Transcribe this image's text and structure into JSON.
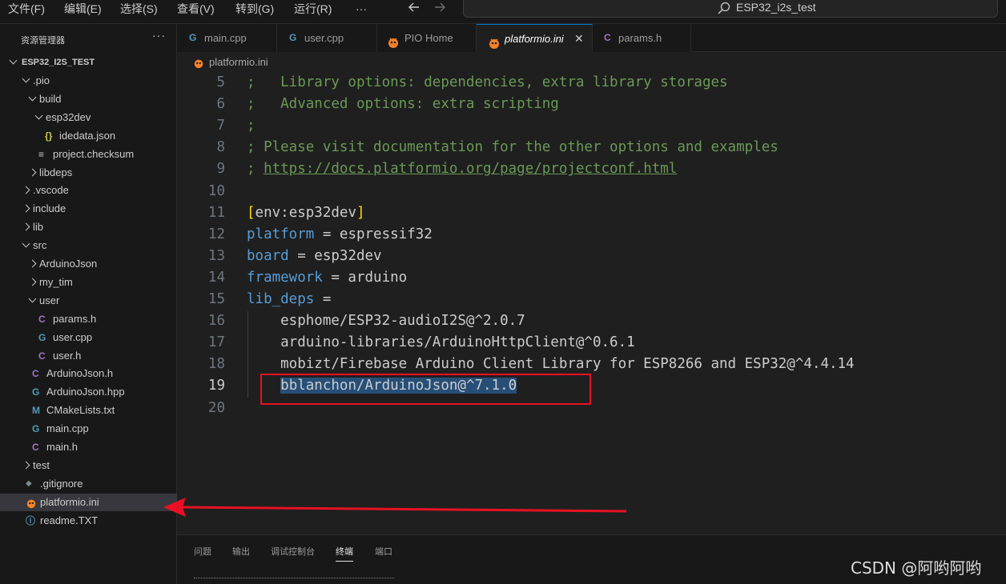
{
  "menu": {
    "items": [
      "文件(F)",
      "编辑(E)",
      "选择(S)",
      "查看(V)",
      "转到(G)",
      "运行(R)",
      "···"
    ],
    "back_icon": "arrow-left-icon",
    "forward_icon": "arrow-right-icon"
  },
  "search": {
    "text": "ESP32_i2s_test",
    "icon": "search-icon"
  },
  "sidebar": {
    "title": "资源管理器",
    "more": "···",
    "root": "ESP32_I2S_TEST",
    "tree": [
      {
        "label": ".pio",
        "kind": "folder-open"
      },
      {
        "label": "build",
        "kind": "folder-open"
      },
      {
        "label": "esp32dev",
        "kind": "folder-open"
      },
      {
        "label": "idedata.json",
        "kind": "json",
        "icon": "{}"
      },
      {
        "label": "project.checksum",
        "kind": "text",
        "icon": "≡"
      },
      {
        "label": "libdeps",
        "kind": "folder-closed"
      },
      {
        "label": ".vscode",
        "kind": "folder-closed"
      },
      {
        "label": "include",
        "kind": "folder-closed"
      },
      {
        "label": "lib",
        "kind": "folder-closed"
      },
      {
        "label": "src",
        "kind": "folder-open"
      },
      {
        "label": "ArduinoJson",
        "kind": "folder-closed"
      },
      {
        "label": "my_tim",
        "kind": "folder-closed"
      },
      {
        "label": "user",
        "kind": "folder-open"
      },
      {
        "label": "params.h",
        "kind": "c-header",
        "icon": "C"
      },
      {
        "label": "user.cpp",
        "kind": "cpp",
        "icon": "G"
      },
      {
        "label": "user.h",
        "kind": "c-header",
        "icon": "C"
      },
      {
        "label": "ArduinoJson.h",
        "kind": "c-header",
        "icon": "C"
      },
      {
        "label": "ArduinoJson.hpp",
        "kind": "cpp",
        "icon": "G"
      },
      {
        "label": "CMakeLists.txt",
        "kind": "cmake",
        "icon": "M"
      },
      {
        "label": "main.cpp",
        "kind": "cpp",
        "icon": "G"
      },
      {
        "label": "main.h",
        "kind": "c-header",
        "icon": "C"
      },
      {
        "label": "test",
        "kind": "folder-closed"
      },
      {
        "label": ".gitignore",
        "kind": "git",
        "icon": "◆"
      },
      {
        "label": "platformio.ini",
        "kind": "pio",
        "icon": "ant",
        "selected": true
      },
      {
        "label": "readme.TXT",
        "kind": "info",
        "icon": "ⓘ"
      }
    ]
  },
  "tabs": [
    {
      "label": "main.cpp",
      "icon": "G",
      "icon_name": "cpp-icon"
    },
    {
      "label": "user.cpp",
      "icon": "G",
      "icon_name": "cpp-icon"
    },
    {
      "label": "PIO Home",
      "icon": "ant",
      "icon_name": "platformio-icon"
    },
    {
      "label": "platformio.ini",
      "icon": "ant",
      "icon_name": "platformio-icon",
      "active": true,
      "close": "✕"
    },
    {
      "label": "params.h",
      "icon": "C",
      "icon_name": "c-header-icon"
    }
  ],
  "breadcrumb": {
    "label": "platformio.ini",
    "icon": "platformio-icon"
  },
  "editor": {
    "lines": [
      {
        "n": "5",
        "tokens": [
          {
            "t": ";   Library options: dependencies, extra library storages",
            "c": "comment"
          }
        ]
      },
      {
        "n": "6",
        "tokens": [
          {
            "t": ";   Advanced options: extra scripting",
            "c": "comment"
          }
        ]
      },
      {
        "n": "7",
        "tokens": [
          {
            "t": ";",
            "c": "comment"
          }
        ]
      },
      {
        "n": "8",
        "tokens": [
          {
            "t": "; Please visit documentation for the other options and examples",
            "c": "comment"
          }
        ]
      },
      {
        "n": "9",
        "tokens": [
          {
            "t": "; ",
            "c": "comment"
          },
          {
            "t": "https://docs.platformio.org/page/projectconf.html",
            "c": "link"
          }
        ]
      },
      {
        "n": "10",
        "tokens": []
      },
      {
        "n": "11",
        "tokens": [
          {
            "t": "[",
            "c": "bracket"
          },
          {
            "t": "env:esp32dev",
            "c": "section"
          },
          {
            "t": "]",
            "c": "bracket"
          }
        ]
      },
      {
        "n": "12",
        "tokens": [
          {
            "t": "platform",
            "c": "key"
          },
          {
            "t": " = espressif32",
            "c": "plain"
          }
        ]
      },
      {
        "n": "13",
        "tokens": [
          {
            "t": "board",
            "c": "key"
          },
          {
            "t": " = esp32dev",
            "c": "plain"
          }
        ]
      },
      {
        "n": "14",
        "tokens": [
          {
            "t": "framework",
            "c": "key"
          },
          {
            "t": " = arduino",
            "c": "plain"
          }
        ]
      },
      {
        "n": "15",
        "tokens": [
          {
            "t": "lib_deps",
            "c": "key"
          },
          {
            "t": " =",
            "c": "plain"
          }
        ]
      },
      {
        "n": "16",
        "tokens": [
          {
            "t": "    esphome/ESP32-audioI2S@^2.0.7",
            "c": "plain"
          }
        ]
      },
      {
        "n": "17",
        "tokens": [
          {
            "t": "    arduino-libraries/ArduinoHttpClient@^0.6.1",
            "c": "plain"
          }
        ]
      },
      {
        "n": "18",
        "tokens": [
          {
            "t": "    mobizt/Firebase Arduino Client Library for ESP8266 and ESP32@^4.4.14",
            "c": "plain"
          }
        ]
      },
      {
        "n": "19",
        "current": true,
        "tokens": [
          {
            "t": "    ",
            "c": "plain"
          },
          {
            "t": "bblanchon/ArduinoJson@^7.1.0",
            "c": "sel"
          }
        ]
      },
      {
        "n": "20",
        "tokens": []
      }
    ]
  },
  "panel": {
    "tabs": [
      "问题",
      "输出",
      "调试控制台",
      "终端",
      "端口"
    ],
    "active": "终端"
  },
  "watermark": "CSDN @阿哟阿哟",
  "colors": {
    "accent": "#0078d4",
    "annotation_red": "#e81123",
    "selection": "#264f78",
    "comment": "#6a9955",
    "keyword": "#569cd6"
  }
}
